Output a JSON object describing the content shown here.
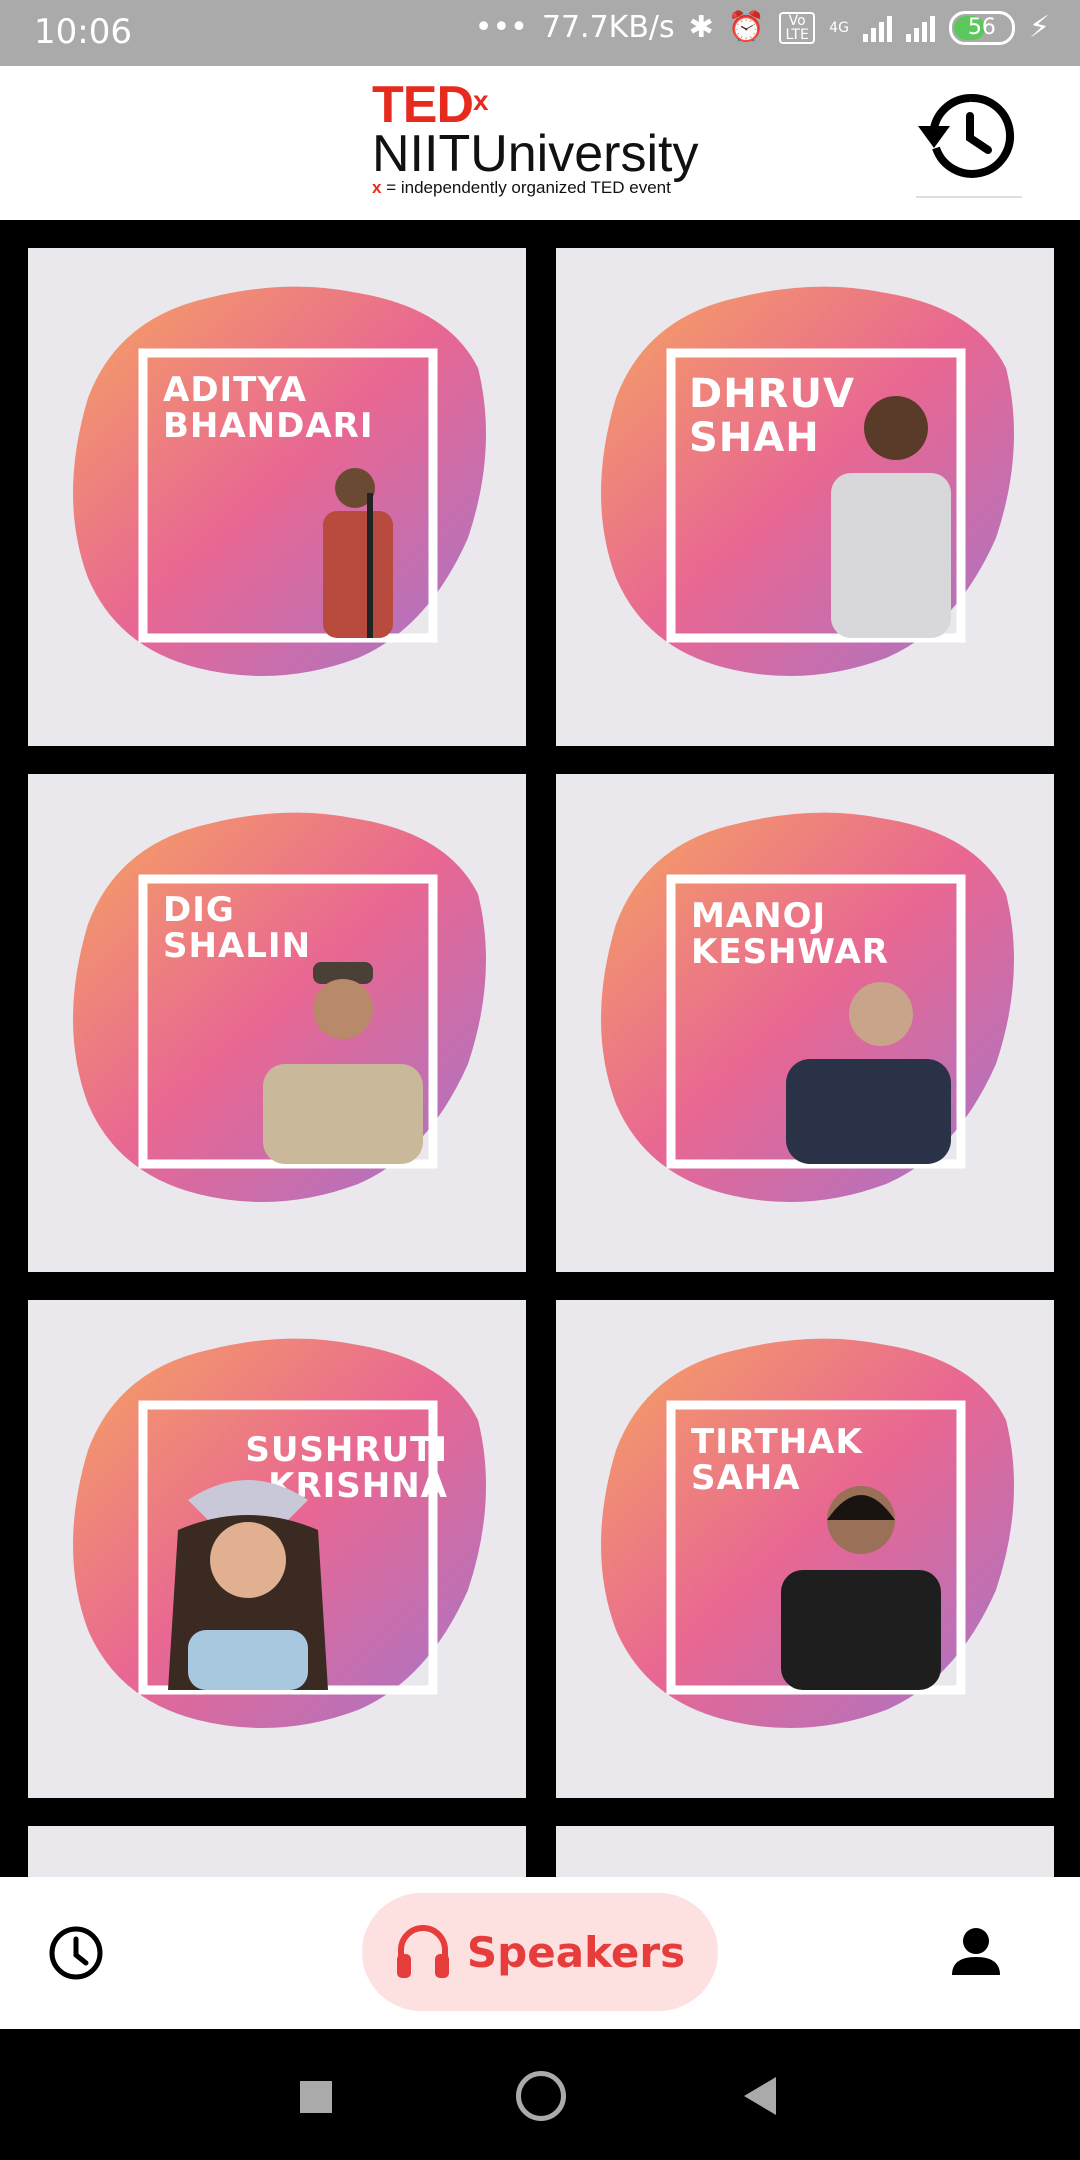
{
  "status_bar": {
    "time": "10:06",
    "speed": "77.7KB/s",
    "network": "4G",
    "volte": "Vo LTE",
    "battery": "56"
  },
  "header": {
    "logo_ted": "TED",
    "logo_x": "x",
    "logo_org": "NIITUniversity",
    "logo_tag_x": "x",
    "logo_tag": " = independently organized TED event",
    "history_icon": "history-icon"
  },
  "speakers": [
    {
      "name": "ADITYA BHANDARI",
      "line1": "ADITYA",
      "line2": "BHANDARI"
    },
    {
      "name": "DHRUV SHAH",
      "line1": "DHRUV",
      "line2": "SHAH"
    },
    {
      "name": "DIG SHALIN",
      "line1": "DIG",
      "line2": "SHALIN"
    },
    {
      "name": "MANOJ KESHWAR",
      "line1": "MANOJ",
      "line2": "KESHWAR"
    },
    {
      "name": "SUSHRUTI KRISHNA",
      "line1": "SUSHRUTI",
      "line2": "KRISHNA"
    },
    {
      "name": "TIRTHAK SAHA",
      "line1": "TIRTHAK",
      "line2": "SAHA"
    }
  ],
  "bottom_nav": {
    "left_icon": "clock-icon",
    "active_label": "Speakers",
    "active_icon": "headphones-icon",
    "right_icon": "person-icon"
  },
  "colors": {
    "accent": "#e63c3c",
    "pill_bg": "#fde0e0",
    "ted_red": "#e62b1e"
  }
}
